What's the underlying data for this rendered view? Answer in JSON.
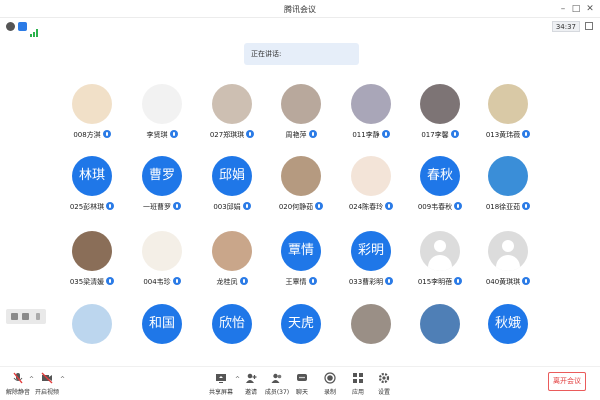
{
  "window": {
    "title": "腾讯会议"
  },
  "status": {
    "timer": "34:37"
  },
  "banner": {
    "speaking_label": "正在讲话:"
  },
  "participants": [
    {
      "name": "008方淇",
      "avatar_text": "",
      "kind": "photo",
      "color": "#f1e0c8"
    },
    {
      "name": "李贤琪",
      "avatar_text": "",
      "kind": "photo",
      "color": "#f2f2f2"
    },
    {
      "name": "027郑琪琪",
      "avatar_text": "",
      "kind": "photo",
      "color": "#cdbfb2"
    },
    {
      "name": "周艳萍",
      "avatar_text": "",
      "kind": "photo",
      "color": "#b8a89c"
    },
    {
      "name": "011李静",
      "avatar_text": "",
      "kind": "photo",
      "color": "#a9a6b8"
    },
    {
      "name": "017李馨",
      "avatar_text": "",
      "kind": "photo",
      "color": "#7d7475"
    },
    {
      "name": "013黄玮薇",
      "avatar_text": "",
      "kind": "photo",
      "color": "#d9c9a6"
    },
    {
      "name": "025彭林琪",
      "avatar_text": "林琪",
      "kind": "text",
      "color": "#1f77e8"
    },
    {
      "name": "一班曹罗",
      "avatar_text": "曹罗",
      "kind": "text",
      "color": "#1f77e8"
    },
    {
      "name": "003邱娟",
      "avatar_text": "邱娟",
      "kind": "text",
      "color": "#1f77e8"
    },
    {
      "name": "020何静茹",
      "avatar_text": "",
      "kind": "photo",
      "color": "#b59a80"
    },
    {
      "name": "024陈春玲",
      "avatar_text": "",
      "kind": "photo",
      "color": "#f3e4d8"
    },
    {
      "name": "009韦春秋",
      "avatar_text": "春秋",
      "kind": "text",
      "color": "#1f77e8"
    },
    {
      "name": "018徐亚茹",
      "avatar_text": "",
      "kind": "photo",
      "color": "#3a8ed8"
    },
    {
      "name": "035梁清媛",
      "avatar_text": "",
      "kind": "photo",
      "color": "#8a6e58"
    },
    {
      "name": "004韦珍",
      "avatar_text": "",
      "kind": "photo",
      "color": "#f4efe7"
    },
    {
      "name": "龙桂凤",
      "avatar_text": "",
      "kind": "photo",
      "color": "#c9a68a"
    },
    {
      "name": "王覃情",
      "avatar_text": "覃情",
      "kind": "text",
      "color": "#1f77e8"
    },
    {
      "name": "033曹彩明",
      "avatar_text": "彩明",
      "kind": "text",
      "color": "#1f77e8"
    },
    {
      "name": "015李明蓓",
      "avatar_text": "",
      "kind": "grey",
      "color": "#dcdcdc"
    },
    {
      "name": "040黄琪琪",
      "avatar_text": "",
      "kind": "grey",
      "color": "#dcdcdc"
    },
    {
      "name": "",
      "avatar_text": "",
      "kind": "photo",
      "color": "#bcd6ee"
    },
    {
      "name": "",
      "avatar_text": "和国",
      "kind": "text",
      "color": "#1f77e8"
    },
    {
      "name": "",
      "avatar_text": "欣怡",
      "kind": "text",
      "color": "#1f77e8"
    },
    {
      "name": "",
      "avatar_text": "天虎",
      "kind": "text",
      "color": "#1f77e8"
    },
    {
      "name": "",
      "avatar_text": "",
      "kind": "photo",
      "color": "#9a8f86"
    },
    {
      "name": "",
      "avatar_text": "",
      "kind": "photo",
      "color": "#4f7fb6"
    },
    {
      "name": "",
      "avatar_text": "秋娥",
      "kind": "text",
      "color": "#1f77e8"
    }
  ],
  "toolbar": {
    "unmute": "解除静音",
    "start_video": "开启视频",
    "share_screen": "共享屏幕",
    "invite": "邀请",
    "members": "成员(37)",
    "chat": "聊天",
    "record": "录制",
    "apps": "应用",
    "settings": "设置",
    "leave": "离开会议"
  },
  "colors": {
    "accent": "#1f77e8",
    "danger": "#e23b3b",
    "banner_bg": "#e6eef9"
  }
}
